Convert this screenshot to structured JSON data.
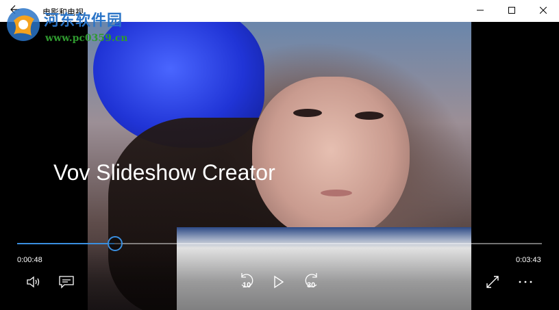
{
  "window": {
    "title": "电影和电视",
    "controls": [
      "minimize-icon",
      "maximize-icon",
      "close-icon"
    ]
  },
  "watermark": {
    "site_name": "河东软件园",
    "url": "www.pc0359.cn"
  },
  "player": {
    "overlay_title": "Vov Slideshow Creator",
    "current_time": "0:00:48",
    "total_time": "0:03:43",
    "progress_fraction": 0.186,
    "accent_color": "#3a8fe0",
    "skip_back_seconds": "10",
    "skip_forward_seconds": "30",
    "icons": [
      "volume-icon",
      "captions-icon",
      "skip-back-icon",
      "play-icon",
      "skip-forward-icon",
      "fullscreen-icon",
      "more-icon"
    ]
  }
}
